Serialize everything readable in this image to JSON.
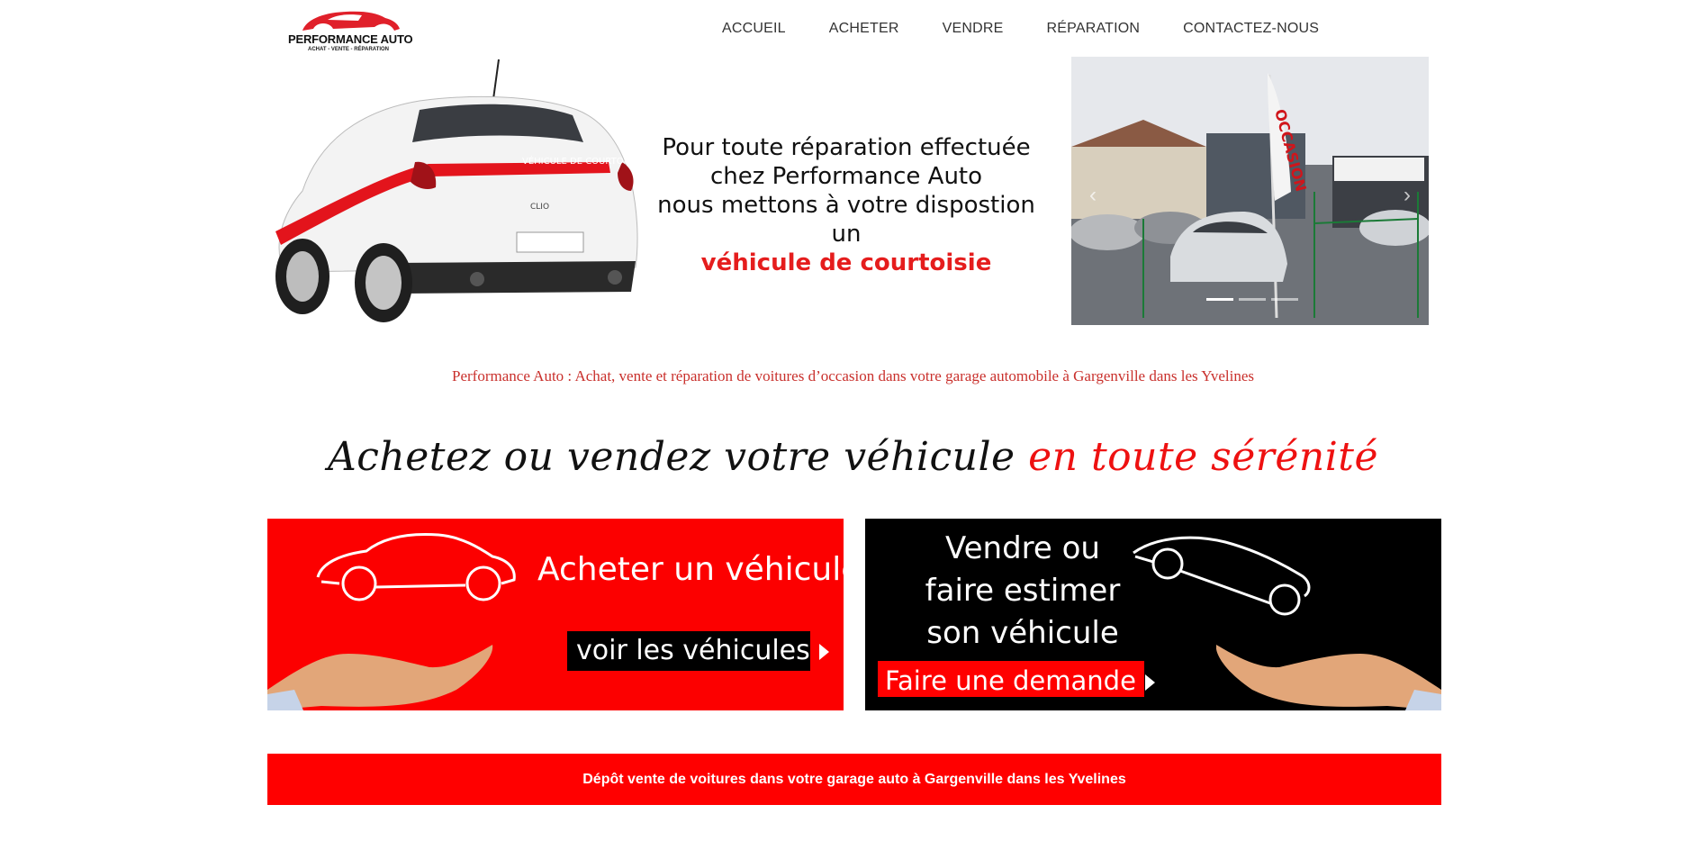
{
  "header": {
    "logo": {
      "text": "PERFORMANCE AUTO",
      "subtitle": "ACHAT - VENTE - RÉPARATION"
    },
    "nav": [
      "ACCUEIL",
      "ACHETER",
      "VENDRE",
      "RÉPARATION",
      "CONTACTEZ-NOUS"
    ]
  },
  "hero": {
    "car_decal": "VÉHICULE DE COURTOISIE",
    "car_model": "CLIO",
    "line1": "Pour toute réparation effectuée",
    "line2": "chez Performance Auto",
    "line3": "nous mettons à votre dispostion un",
    "line4": "véhicule de courtoisie"
  },
  "slider": {
    "flag_text": "OCCASION",
    "slide_count": 3,
    "active_slide": 1
  },
  "tagline": "Performance Auto : Achat, vente et réparation de voitures d’occasion dans votre garage automobile à Gargenville dans les Yvelines",
  "section_heading": {
    "part1": "Achetez ou vendez votre véhicule",
    "part2": "en toute sérénité"
  },
  "panels": {
    "buy": {
      "title": "Acheter un véhicule",
      "button": "voir les véhicules"
    },
    "sell": {
      "title_line1": "Vendre ou",
      "title_line2": "faire estimer",
      "title_line3": "son véhicule",
      "button": "Faire une demande"
    }
  },
  "banner": "Dépôt vente de voitures dans votre garage auto à Gargenville dans les Yvelines",
  "colors": {
    "accent": "#ff0000",
    "dark": "#000000",
    "tagline": "#c9302c"
  }
}
